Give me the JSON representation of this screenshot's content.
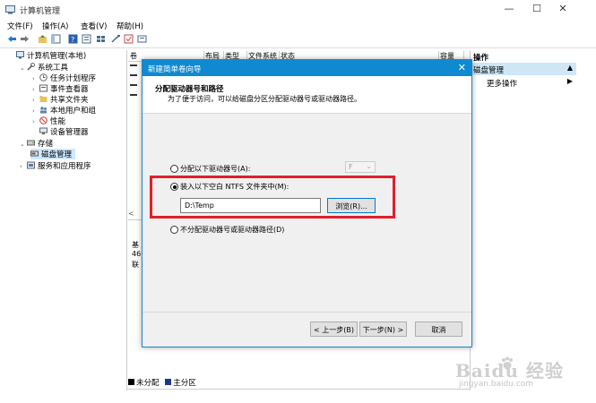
{
  "window": {
    "title": "计算机管理",
    "min": "—",
    "max": "☐",
    "close": "✕"
  },
  "menu": [
    "文件(F)",
    "操作(A)",
    "查看(V)",
    "帮助(H)"
  ],
  "tree": {
    "root": "计算机管理(本地)",
    "items": [
      "系统工具",
      "任务计划程序",
      "事件查看器",
      "共享文件夹",
      "本地用户和组",
      "性能",
      "设备管理器",
      "存储",
      "磁盘管理",
      "服务和应用程序"
    ]
  },
  "columns": [
    "卷",
    "布局",
    "类型",
    "文件系统",
    "状态",
    "容量"
  ],
  "left_fragments": [
    "基",
    "46",
    "联"
  ],
  "actions": {
    "header": "操作",
    "section": "磁盘管理",
    "more": "更多操作"
  },
  "legend": {
    "unallocated": "未分配",
    "primary": "主分区"
  },
  "dialog": {
    "title": "新建简单卷向导",
    "heading": "分配驱动器号和路径",
    "subheading": "为了便于访问，可以给磁盘分区分配驱动器号或驱动器路径。",
    "option_letter": "分配以下驱动器号(A):",
    "letter_value": "F",
    "option_folder": "装入以下空白 NTFS 文件夹中(M):",
    "folder_value": "D:\\Temp",
    "browse": "浏览(R)...",
    "option_none": "不分配驱动器号或驱动器路径(D)",
    "back": "< 上一步(B)",
    "next": "下一步(N) >",
    "cancel": "取消"
  },
  "watermark": {
    "brand": "Baidu 经验",
    "url": "jingyan.baidu.com"
  },
  "colors": {
    "dialog_titlebar": "#0f8ad1",
    "highlight_box": "#e0202a",
    "selection": "#cde8ff"
  }
}
